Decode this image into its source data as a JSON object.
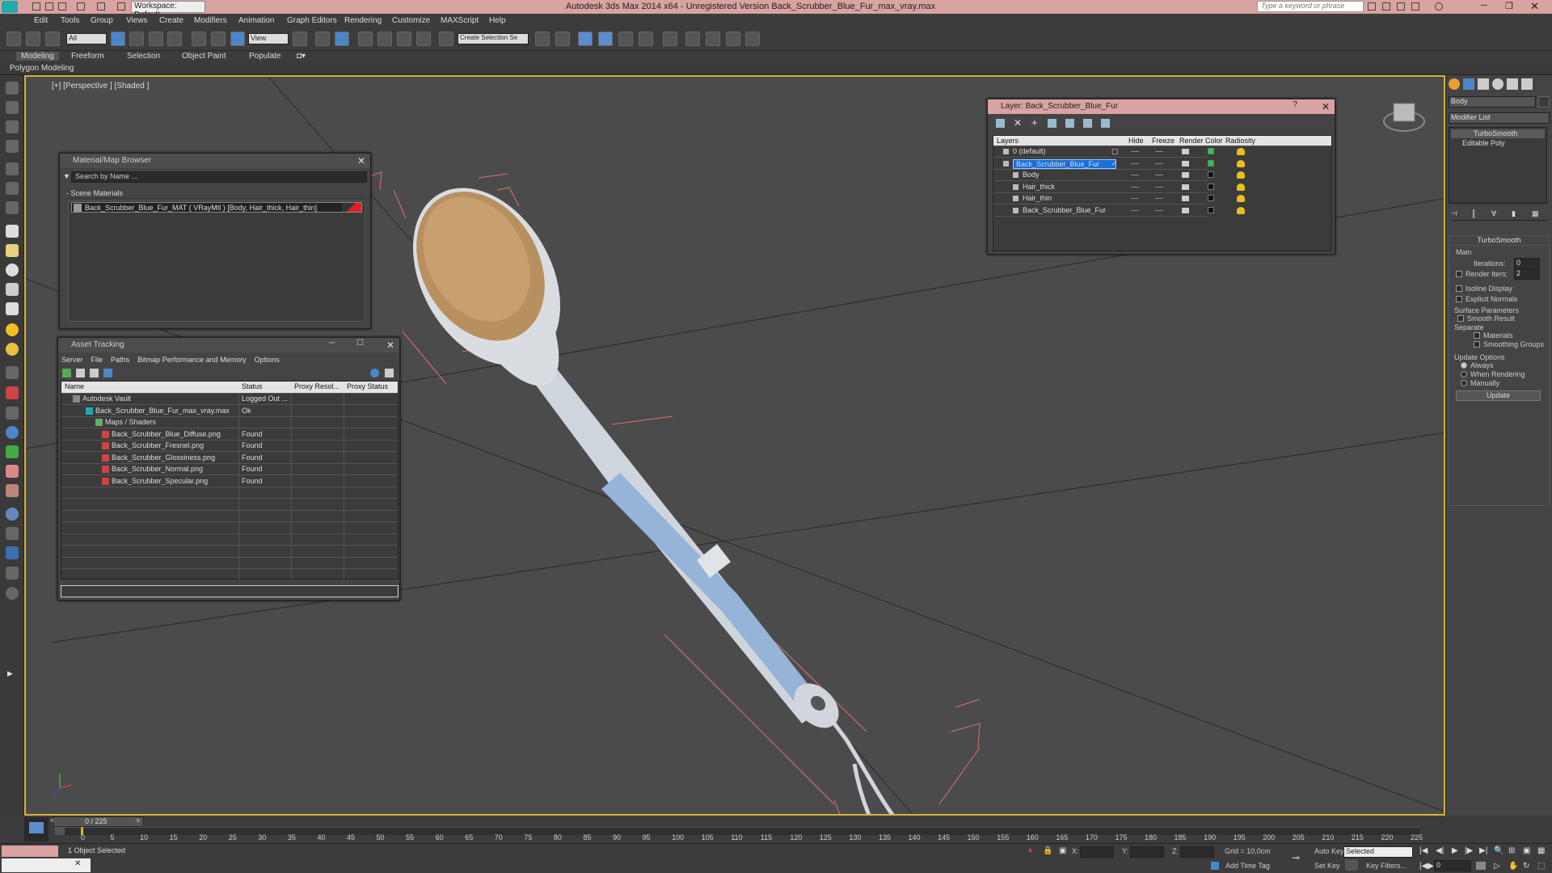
{
  "titlebar": {
    "workspace": "Workspace: Default",
    "title": "Autodesk 3ds Max  2014 x64 - Unregistered Version   Back_Scrubber_Blue_Fur_max_vray.max",
    "search_placeholder": "Type a keyword or phrase"
  },
  "menu": [
    "Edit",
    "Tools",
    "Group",
    "Views",
    "Create",
    "Modifiers",
    "Animation",
    "Graph Editors",
    "Rendering",
    "Customize",
    "MAXScript",
    "Help"
  ],
  "toolbar": {
    "filter": "All",
    "refcoord": "View",
    "selset": "Create Selection Se"
  },
  "ribbon": {
    "tabs": [
      "Modeling",
      "Freeform",
      "Selection",
      "Object Paint",
      "Populate"
    ],
    "subtab": "Polygon Modeling"
  },
  "viewport": {
    "label": "[+] [Perspective ] [Shaded ]"
  },
  "matbrowser": {
    "title": "Material/Map Browser",
    "search": "Search by Name ...",
    "section": "- Scene Materials",
    "item": "Back_Scrubber_Blue_Fur_MAT  ( VRayMtl ) [Body, Hair_thick, Hair_thin]"
  },
  "asset": {
    "title": "Asset Tracking",
    "menu": [
      "Server",
      "File",
      "Paths",
      "Bitmap Performance and Memory",
      "Options"
    ],
    "columns": [
      "Name",
      "Status",
      "Proxy Resol...",
      "Proxy Status"
    ],
    "rows": [
      {
        "name": "Autodesk Vault",
        "status": "Logged Out ..."
      },
      {
        "name": "Back_Scrubber_Blue_Fur_max_vray.max",
        "status": "Ok"
      },
      {
        "name": "Maps / Shaders",
        "status": ""
      },
      {
        "name": "Back_Scrubber_Blue_Diffuse.png",
        "status": "Found"
      },
      {
        "name": "Back_Scrubber_Fresnel.png",
        "status": "Found"
      },
      {
        "name": "Back_Scrubber_Glossiness.png",
        "status": "Found"
      },
      {
        "name": "Back_Scrubber_Normal.png",
        "status": "Found"
      },
      {
        "name": "Back_Scrubber_Specular.png",
        "status": "Found"
      }
    ]
  },
  "layer": {
    "title": "Layer: Back_Scrubber_Blue_Fur",
    "columns": [
      "Layers",
      "Hide",
      "Freeze",
      "Render",
      "Color",
      "Radiosity"
    ],
    "rows": [
      {
        "name": "0 (default)",
        "color": "#22cc44"
      },
      {
        "name": "Back_Scrubber_Blue_Fur",
        "color": "#22cc44"
      },
      {
        "name": "Body",
        "color": "#111111"
      },
      {
        "name": "Hair_thick",
        "color": "#111111"
      },
      {
        "name": "Hair_thin",
        "color": "#111111"
      },
      {
        "name": "Back_Scrubber_Blue_Fur",
        "color": "#111111"
      }
    ]
  },
  "cmd": {
    "object": "Body",
    "modlist": "Modifier List",
    "stack": [
      "TurboSmooth",
      "Editable Poly"
    ],
    "rollout": "TurboSmooth",
    "main": "Main",
    "iterations_label": "Iterations:",
    "iterations": "0",
    "render_iters_label": "Render Iters:",
    "render_iters": "2",
    "isoline": "Isoline Display",
    "explicit": "Explicit Normals",
    "surface": "Surface Parameters",
    "smooth": "Smooth Result",
    "separate": "Separate",
    "materials": "Materials",
    "smoothing": "Smoothing Groups",
    "update_opts": "Update Options",
    "always": "Always",
    "when": "When Rendering",
    "manually": "Manually",
    "update": "Update"
  },
  "timeline": {
    "frame": "0 / 225",
    "ticks": [
      "0",
      "5",
      "10",
      "15",
      "20",
      "25",
      "30",
      "35",
      "40",
      "45",
      "50",
      "55",
      "60",
      "65",
      "70",
      "75",
      "80",
      "85",
      "90",
      "95",
      "100",
      "105",
      "110",
      "115",
      "120",
      "125",
      "130",
      "135",
      "140",
      "145",
      "150",
      "155",
      "160",
      "165",
      "170",
      "175",
      "180",
      "185",
      "190",
      "195",
      "200",
      "205",
      "210",
      "215",
      "220",
      "225"
    ]
  },
  "status": {
    "selected": "1 Object Selected",
    "x": "X:",
    "y": "Y:",
    "z": "Z:",
    "grid": "Grid = 10,0cm",
    "autokey": "Auto Key",
    "selected_dd": "Selected",
    "setkey": "Set Key",
    "keyfilters": "Key Filters...",
    "addtime": "Add Time Tag",
    "frame": "0"
  }
}
